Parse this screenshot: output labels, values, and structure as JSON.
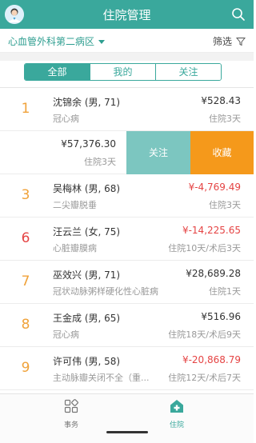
{
  "header": {
    "title": "住院管理"
  },
  "subbar": {
    "department": "心血管外科第二病区",
    "filter_label": "筛选"
  },
  "tabs": [
    {
      "label": "全部",
      "active": true
    },
    {
      "label": "我的",
      "active": false
    },
    {
      "label": "关注",
      "active": false
    }
  ],
  "patients": [
    {
      "bed": "1",
      "bed_color": "orange",
      "name": "沈锦余 (男, 71)",
      "diagnosis": "冠心病",
      "amount": "¥528.43",
      "negative": false,
      "stay": "住院3天"
    },
    {
      "bed": "",
      "bed_color": "orange",
      "name": "",
      "diagnosis": "",
      "amount": "¥57,376.30",
      "negative": false,
      "stay": "住院3天",
      "swiped": true,
      "actions": {
        "follow": "关注",
        "favorite": "收藏"
      }
    },
    {
      "bed": "3",
      "bed_color": "orange",
      "name": "吴梅林 (男, 68)",
      "diagnosis": "二尖瓣脱垂",
      "amount": "¥-4,769.49",
      "negative": true,
      "stay": "住院3天"
    },
    {
      "bed": "6",
      "bed_color": "red",
      "name": "汪云兰 (女, 75)",
      "diagnosis": "心脏瓣膜病",
      "amount": "¥-14,225.65",
      "negative": true,
      "stay": "住院10天/术后3天"
    },
    {
      "bed": "7",
      "bed_color": "orange",
      "name": "巫效兴 (男, 71)",
      "diagnosis": "冠状动脉粥样硬化性心脏病",
      "amount": "¥28,689.28",
      "negative": false,
      "stay": "住院1天"
    },
    {
      "bed": "8",
      "bed_color": "orange",
      "name": "王金成 (男, 65)",
      "diagnosis": "冠心病",
      "amount": "¥516.96",
      "negative": false,
      "stay": "住院18天/术后9天"
    },
    {
      "bed": "9",
      "bed_color": "orange",
      "name": "许可伟 (男, 58)",
      "diagnosis": "主动脉瓣关闭不全（重...",
      "amount": "¥-20,868.79",
      "negative": true,
      "stay": "住院12天/术后7天"
    }
  ],
  "bottom_nav": [
    {
      "label": "事务",
      "icon": "grid-icon",
      "active": false
    },
    {
      "label": "住院",
      "icon": "hospital-icon",
      "active": true
    }
  ],
  "colors": {
    "primary": "#3aa89c",
    "follow": "#7cc6c0",
    "favorite": "#f5991b",
    "negative": "#e54444",
    "bed_orange": "#f0a23a",
    "bed_red": "#e54444"
  }
}
